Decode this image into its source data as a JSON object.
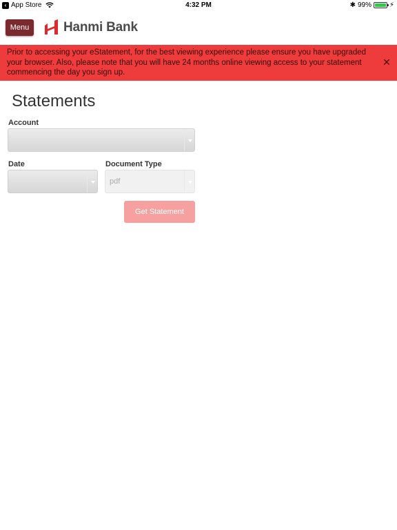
{
  "status_bar": {
    "back_app": "App Store",
    "time": "4:32 PM",
    "battery": "99%",
    "battery_level": 0.99
  },
  "header": {
    "menu_label": "Menu",
    "logo_text": "Hanmi Bank"
  },
  "alert": {
    "message": "Prior to accessing your eStatement, for the best viewing experience please ensure you have upgraded your browser. Also, please note that you will have 24 months online viewing access to your statement commencing the day you sign up.",
    "close_icon": "close-icon"
  },
  "main": {
    "title": "Statements",
    "account_label": "Account",
    "account_value": "",
    "date_label": "Date",
    "date_value": "",
    "doc_type_label": "Document Type",
    "doc_type_value": "pdf",
    "submit_label": "Get Statement"
  },
  "colors": {
    "brand": "#7a2a2e",
    "alert_bg": "#ee3b3b",
    "button_disabled": "#f7a0a0"
  }
}
